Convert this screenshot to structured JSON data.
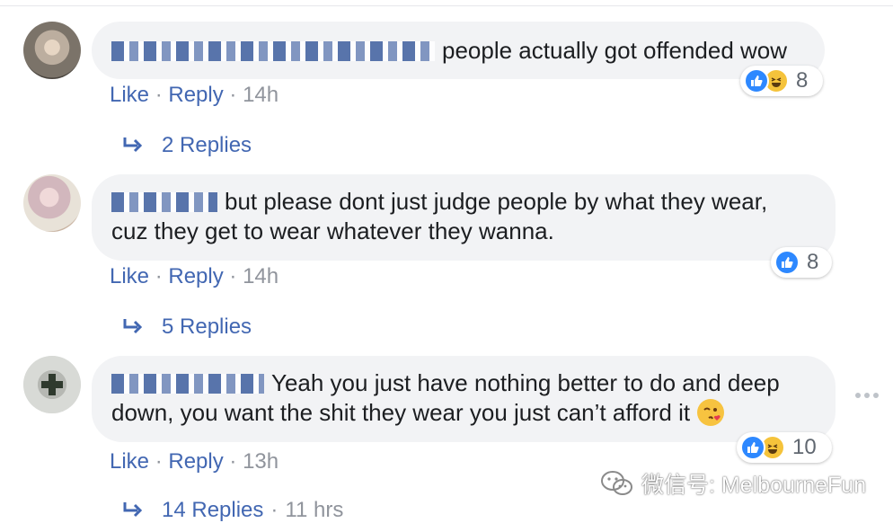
{
  "comments": [
    {
      "text": "people actually got offended wow",
      "actions": {
        "like": "Like",
        "reply": "Reply",
        "time": "14h"
      },
      "reaction_count": "8",
      "reactions": [
        "like",
        "haha"
      ],
      "replies_label": "2 Replies"
    },
    {
      "text_line1": "but please dont just judge people by what they wear,",
      "text_line2": "cuz they get to wear whatever they wanna.",
      "actions": {
        "like": "Like",
        "reply": "Reply",
        "time": "14h"
      },
      "reaction_count": "8",
      "reactions": [
        "like"
      ],
      "replies_label": "5 Replies"
    },
    {
      "text_line1": "Yeah you just have nothing better to do and deep",
      "text_line2": "down, you want the shit they wear you just can’t afford it",
      "emoji": "winking-kiss-emoji",
      "actions": {
        "like": "Like",
        "reply": "Reply",
        "time": "13h"
      },
      "reaction_count": "10",
      "reactions": [
        "like",
        "haha"
      ],
      "replies_label": "14 Replies",
      "replies_time": "11 hrs"
    }
  ],
  "separator": "·",
  "watermark": {
    "text": "微信号: MelbourneFun",
    "icon": "wechat-icon"
  },
  "colors": {
    "link": "#4267b2",
    "bubble": "#f2f3f5",
    "like_blue": "#2d88ff",
    "haha_yellow": "#f5c33b",
    "muted": "#90949c"
  }
}
